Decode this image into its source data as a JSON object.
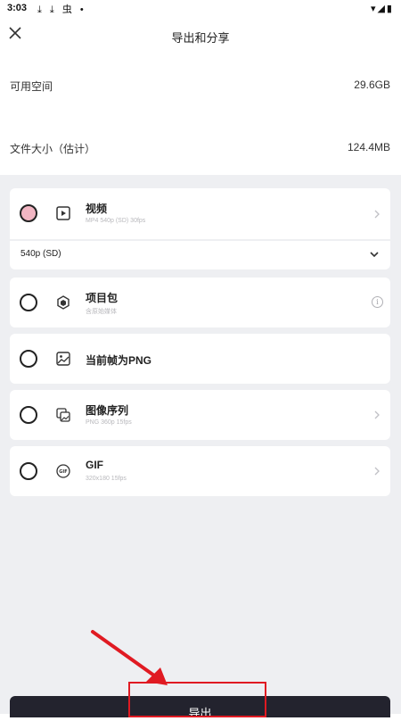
{
  "status_bar": {
    "time": "3:03",
    "left_icons": "⤓ ⤓ 虫 •",
    "right_icons": "▾◢▮"
  },
  "header": {
    "title": "导出和分享"
  },
  "info": {
    "available_space_label": "可用空间",
    "available_space_value": "29.6GB",
    "file_size_label": "文件大小（估计）",
    "file_size_value": "124.4MB"
  },
  "options": [
    {
      "title": "视频",
      "subtitle": "MP4 540p (SD) 30fps",
      "selected": true,
      "icon": "video-play-icon",
      "trailing": "chevron-right"
    },
    {
      "title": "项目包",
      "subtitle": "含原始媒体",
      "selected": false,
      "icon": "package-icon",
      "trailing": "info"
    },
    {
      "title": "当前帧为PNG",
      "subtitle": "",
      "selected": false,
      "icon": "image-icon",
      "trailing": "none"
    },
    {
      "title": "图像序列",
      "subtitle": "PNG 360p 15fps",
      "selected": false,
      "icon": "image-sequence-icon",
      "trailing": "chevron-right"
    },
    {
      "title": "GIF",
      "subtitle": "320x180 15fps",
      "selected": false,
      "icon": "gif-icon",
      "trailing": "chevron-right"
    }
  ],
  "resolution": {
    "value": "540p (SD)"
  },
  "export_button": {
    "label": "导出"
  },
  "colors": {
    "accent_radio": "#f2b6c3",
    "highlight": "#e01a22",
    "export_bg": "#23232e",
    "panel_bg": "#eeeff2"
  }
}
